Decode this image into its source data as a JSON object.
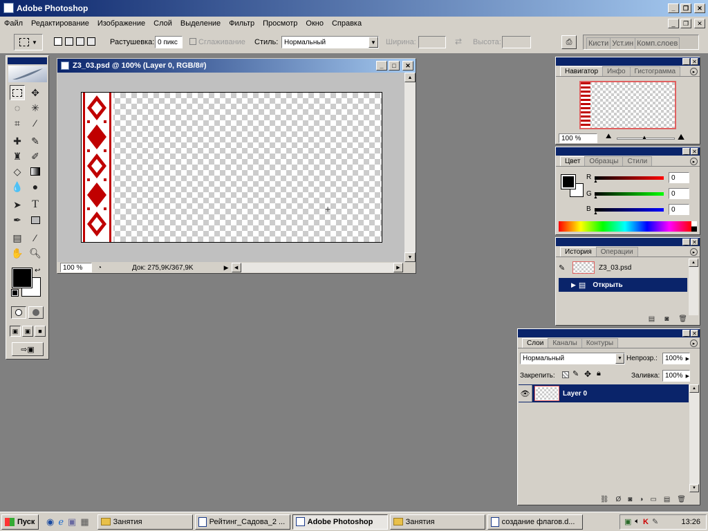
{
  "app": {
    "title": "Adobe Photoshop"
  },
  "menu": [
    "Файл",
    "Редактирование",
    "Изображение",
    "Слой",
    "Выделение",
    "Фильтр",
    "Просмотр",
    "Окно",
    "Справка"
  ],
  "options": {
    "feather_label": "Растушевка:",
    "feather_value": "0 пикс",
    "antialias_label": "Сглаживание",
    "style_label": "Стиль:",
    "style_value": "Нормальный",
    "width_label": "Ширина:",
    "height_label": "Высота:",
    "well_tabs": [
      "Кисти",
      "Уст.ин",
      "Комп.слоев"
    ]
  },
  "document": {
    "title": "Z3_03.psd @ 100% (Layer 0, RGB/8#)",
    "zoom": "100 %",
    "doc_info": "Док: 275,9K/367,9K"
  },
  "navigator": {
    "tabs": [
      "Навигатор",
      "Инфо",
      "Гистограмма"
    ],
    "zoom": "100 %"
  },
  "color": {
    "tabs": [
      "Цвет",
      "Образцы",
      "Стили"
    ],
    "r_label": "R",
    "g_label": "G",
    "b_label": "B",
    "r": "0",
    "g": "0",
    "b": "0"
  },
  "history": {
    "tabs": [
      "История",
      "Операции"
    ],
    "snapshot": "Z3_03.psd",
    "step": "Открыть"
  },
  "layers": {
    "tabs": [
      "Слои",
      "Каналы",
      "Контуры"
    ],
    "blend_mode": "Нормальный",
    "opacity_label": "Непрозр.:",
    "opacity": "100%",
    "lock_label": "Закрепить:",
    "fill_label": "Заливка:",
    "fill": "100%",
    "layer_name": "Layer 0"
  },
  "taskbar": {
    "start": "Пуск",
    "tasks": [
      "Занятия",
      "Рейтинг_Садова_2 ...",
      "Adobe Photoshop",
      "Занятия",
      "создание флагов.d..."
    ],
    "clock": "13:26"
  },
  "colors": {
    "accent": "#0a246a",
    "ornament": "#c00000"
  }
}
